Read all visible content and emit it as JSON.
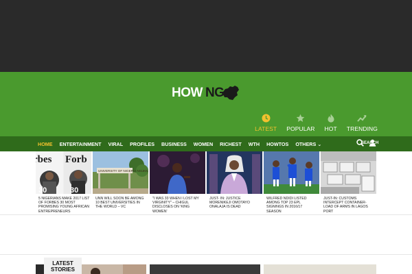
{
  "brand": {
    "logo_text": "HOW",
    "logo_ng": "NG"
  },
  "feed_tabs": [
    {
      "label": "LATEST",
      "icon": "clock-icon",
      "active": true
    },
    {
      "label": "POPULAR",
      "icon": "star-icon",
      "active": false
    },
    {
      "label": "HOT",
      "icon": "flame-icon",
      "active": false
    },
    {
      "label": "TRENDING",
      "icon": "trending-icon",
      "active": false
    }
  ],
  "nav": {
    "items": [
      "HOME",
      "ENTERTAINMENT",
      "VIRAL",
      "PROFILES",
      "BUSINESS",
      "WOMEN",
      "RICHEST",
      "WTH",
      "HOWTOS",
      "OTHERS"
    ],
    "search_label": "SEARCH"
  },
  "stories": [
    {
      "caption": "5 NIGERIANS MAKE 2017 LIST OF FORBES 30 MOST PROMISING YOUNG AFRICAN ENTREPRENEURS",
      "image": "forbes-covers"
    },
    {
      "caption": "UNN WILL SOON BE AMONG 10 BEST UNIVERSITIES IN THE WORLD – VC",
      "image": "university-gate"
    },
    {
      "caption": "\"I WAS 33 WHEN I LOST MY VIRGINITY\" – CHIGUL DISCLOSES ON 'KING WOMEN'",
      "image": "woman-on-stage"
    },
    {
      "caption": "JUST- IN: JUSTICE MORENIKEJI OMOTAYO ONALAJA IS DEAD",
      "image": "judge-portrait"
    },
    {
      "caption": "WILFRED NDIDI LISTED AMONG TOP 23 EPL SIGNINGS IN 2016/17 SEASON",
      "image": "football-players"
    },
    {
      "caption": "JUST-IN: CUSTOMS INTERCEPT CONTAINER-LOAD OF ARMS IN LAGOS PORT",
      "image": "arms-boxes"
    }
  ],
  "latest_stories": {
    "line1": "LATEST",
    "line2": "STORIES"
  },
  "colors": {
    "header_green": "#4a9a2e",
    "nav_green": "#2f6b1b",
    "accent_yellow": "#f2c12e",
    "topbar": "#2a2a2a"
  }
}
